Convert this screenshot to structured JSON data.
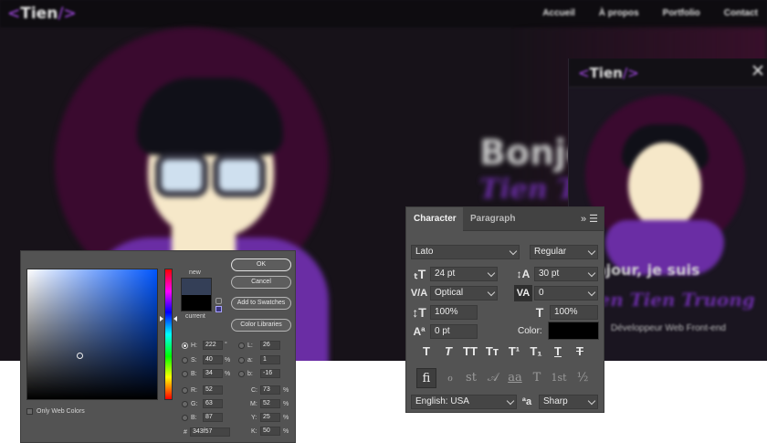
{
  "website": {
    "logo": "Tien",
    "nav": [
      "Accueil",
      "À propos",
      "Portfolio",
      "Contact"
    ],
    "hero_greeting": "Bonjour,",
    "hero_name": "Tien Tien",
    "accent": "#6a2da4"
  },
  "mobile_preview": {
    "logo": "Tien",
    "greeting": "Bonjour, je suis",
    "name": "Tien Tien Truong",
    "description": "Développeur Web Front-end"
  },
  "color_picker": {
    "labels": {
      "new": "new",
      "current": "current",
      "only_web": "Only Web Colors",
      "hex_prefix": "#"
    },
    "buttons": {
      "ok": "OK",
      "cancel": "Cancel",
      "add_swatch": "Add to Swatches",
      "libraries": "Color Libraries"
    },
    "new_color": "#343f57",
    "current_color": "#000000",
    "hsb": [
      {
        "label": "H:",
        "value": "222",
        "unit": "°",
        "selected": true
      },
      {
        "label": "S:",
        "value": "40",
        "unit": "%"
      },
      {
        "label": "B:",
        "value": "34",
        "unit": "%"
      }
    ],
    "rgb": [
      {
        "label": "R:",
        "value": "52"
      },
      {
        "label": "G:",
        "value": "63"
      },
      {
        "label": "B:",
        "value": "87"
      }
    ],
    "lab": [
      {
        "label": "L:",
        "value": "26"
      },
      {
        "label": "a:",
        "value": "1"
      },
      {
        "label": "b:",
        "value": "-16"
      }
    ],
    "cmyk": [
      {
        "label": "C:",
        "value": "73",
        "unit": "%"
      },
      {
        "label": "M:",
        "value": "52",
        "unit": "%"
      },
      {
        "label": "Y:",
        "value": "25",
        "unit": "%"
      },
      {
        "label": "K:",
        "value": "50",
        "unit": "%"
      }
    ],
    "hex": "343f57"
  },
  "character_panel": {
    "tabs": {
      "active": "Character",
      "inactive": "Paragraph"
    },
    "menu_icons": "»  ☰",
    "font_family": "Lato",
    "font_style": "Regular",
    "font_size": "24 pt",
    "leading": "30 pt",
    "kerning": "Optical",
    "tracking": "0",
    "vertical_scale": "100%",
    "horizontal_scale": "100%",
    "baseline_shift": "0 pt",
    "color_label": "Color:",
    "color": "#000000",
    "language": "English: USA",
    "antialias": "Sharp",
    "style_buttons": [
      "T",
      "T",
      "TT",
      "Tт",
      "T¹",
      "T₁",
      "T",
      "T"
    ],
    "opentype_buttons": [
      "ﬁ",
      "ℴ",
      "st",
      "𝒜",
      "aa",
      "T",
      "1st",
      "½"
    ]
  }
}
